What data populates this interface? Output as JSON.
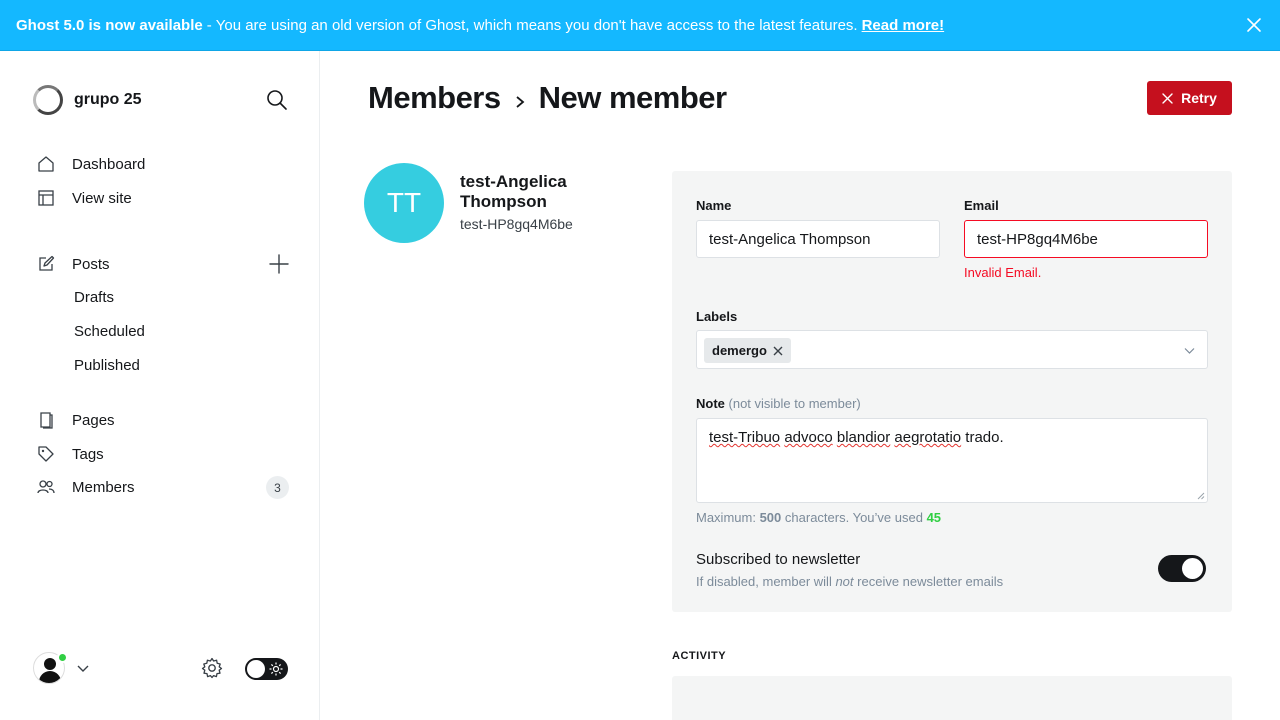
{
  "banner": {
    "strong": "Ghost 5.0 is now available",
    "sep": "-",
    "message": "You are using an old version of Ghost, which means you don't have access to the latest features.",
    "link": "Read more!"
  },
  "sidebar": {
    "site_name": "grupo 25",
    "nav": {
      "dashboard": "Dashboard",
      "view_site": "View site",
      "posts": "Posts",
      "drafts": "Drafts",
      "scheduled": "Scheduled",
      "published": "Published",
      "pages": "Pages",
      "tags": "Tags",
      "members": "Members",
      "members_count": "3"
    }
  },
  "header": {
    "breadcrumb_parent": "Members",
    "title": "New member",
    "retry_label": "Retry"
  },
  "member": {
    "initials": "TT",
    "name": "test-Angelica Thompson",
    "email": "test-HP8gq4M6be"
  },
  "form": {
    "name_label": "Name",
    "name_value": "test-Angelica Thompson",
    "email_label": "Email",
    "email_value": "test-HP8gq4M6be",
    "email_error": "Invalid Email.",
    "labels_label": "Labels",
    "labels": [
      "demergo"
    ],
    "note_label": "Note",
    "note_muted": "(not visible to member)",
    "note_value_words": [
      "test-Tribuo",
      "advoco",
      "blandior",
      "aegrotatio",
      "trado."
    ],
    "hint_prefix": "Maximum:",
    "hint_max": "500",
    "hint_mid": "characters. You’ve used",
    "hint_used": "45",
    "subscribed_label": "Subscribed to newsletter",
    "subscribed_desc_1": "If disabled, member will",
    "subscribed_desc_em": "not",
    "subscribed_desc_2": "receive newsletter emails",
    "subscribed": true
  },
  "activity": {
    "heading": "ACTIVITY"
  },
  "colors": {
    "banner": "#14b8ff",
    "accent_red": "#c5101e",
    "avatar": "#35cde0",
    "error": "#f50b23",
    "success": "#30cf43"
  }
}
